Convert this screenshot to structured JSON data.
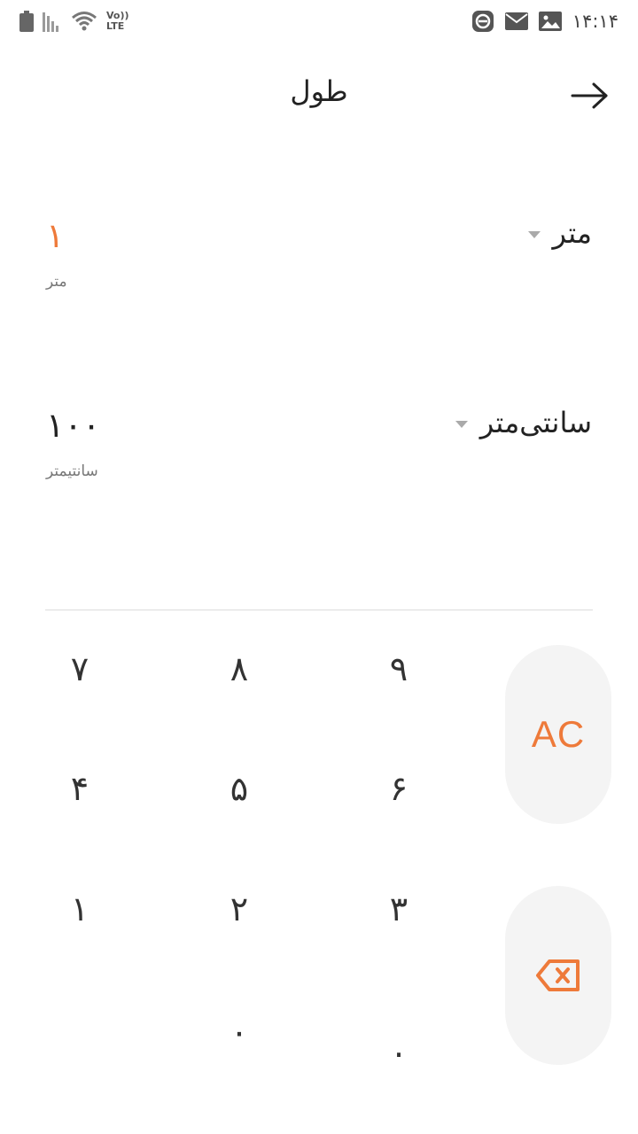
{
  "status_bar": {
    "time": "۱۴:۱۴",
    "network_label_top": "Vo))",
    "network_label_bottom": "LTE",
    "icons": [
      "battery-icon",
      "signal-icon",
      "wifi-icon",
      "app-notification-icon",
      "mail-icon",
      "gallery-icon"
    ]
  },
  "header": {
    "title": "طول",
    "back_icon": "arrow-right-icon"
  },
  "from": {
    "unit": "متر",
    "value": "۱",
    "unit_label": "متر"
  },
  "to": {
    "unit": "سانتی‌متر",
    "value": "۱۰۰",
    "unit_label": "سانتیمتر"
  },
  "keypad": {
    "row1": [
      "۷",
      "۸",
      "۹"
    ],
    "row2": [
      "۴",
      "۵",
      "۶"
    ],
    "row3": [
      "۱",
      "۲",
      "۳"
    ],
    "zero": "۰",
    "decimal": ".",
    "clear": "AC",
    "backspace_icon": "backspace-icon"
  },
  "colors": {
    "accent": "#ee7a3a",
    "side_button_bg": "#f4f4f4",
    "text": "#222222"
  }
}
